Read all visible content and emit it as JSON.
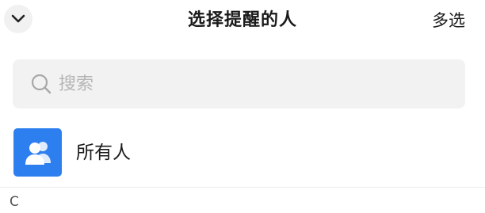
{
  "header": {
    "back_icon": "chevron-down-icon",
    "title": "选择提醒的人",
    "multi_select_label": "多选"
  },
  "search": {
    "icon": "search-icon",
    "placeholder": "搜索"
  },
  "everyone": {
    "icon": "group-users-icon",
    "label": "所有人",
    "accent_color": "#2d7ff0"
  },
  "sections": [
    {
      "letter": "C"
    }
  ]
}
